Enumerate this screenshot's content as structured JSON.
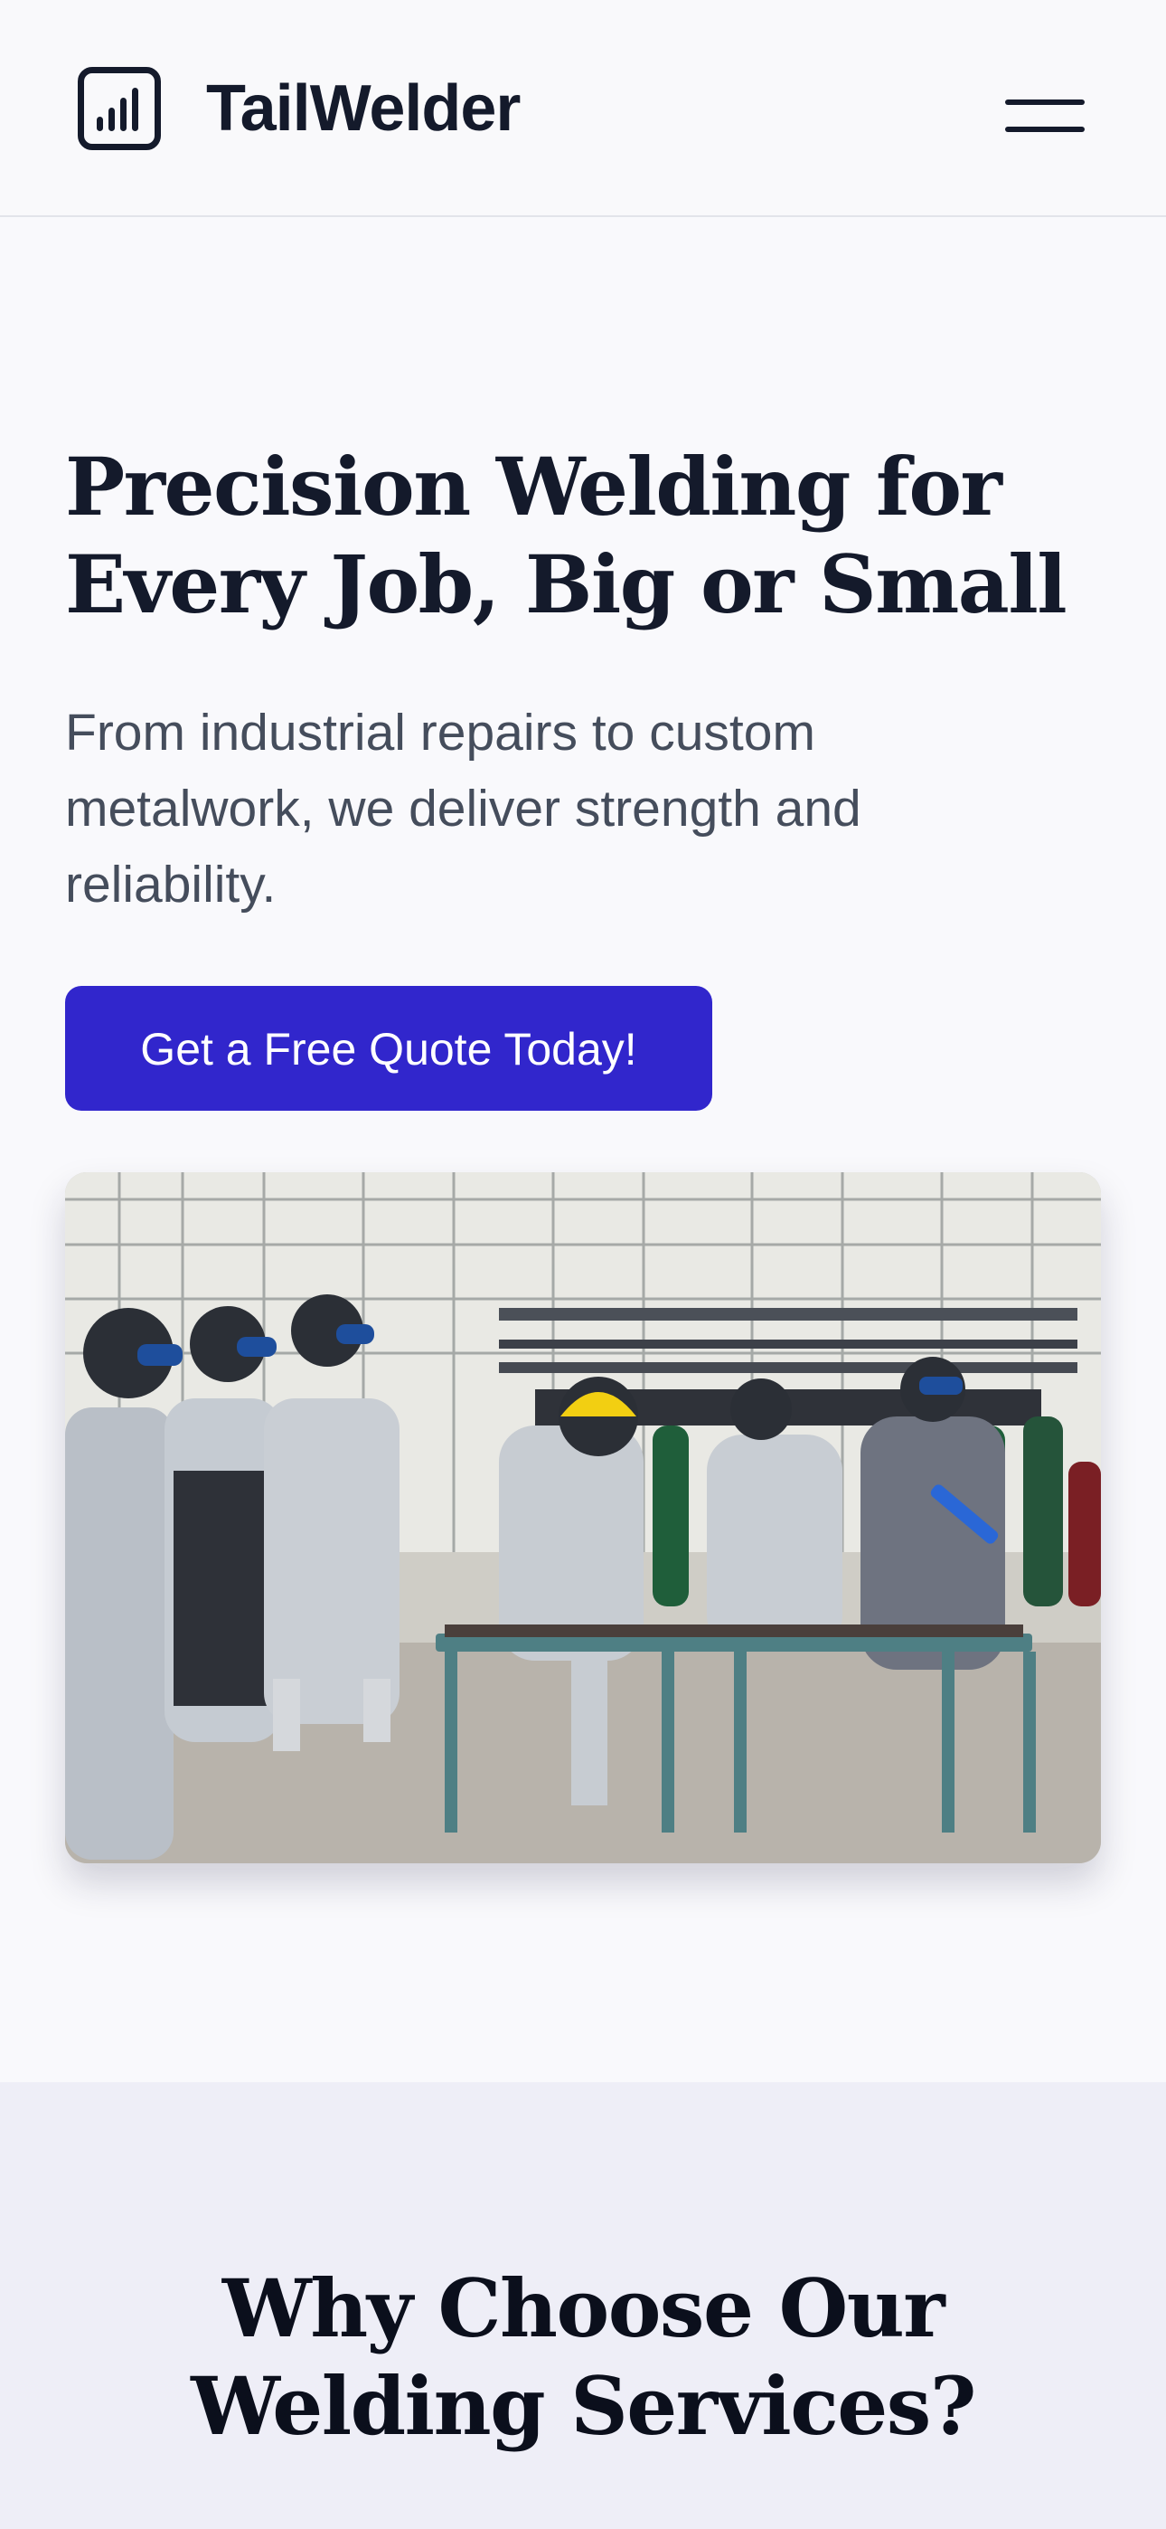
{
  "header": {
    "brand": "TailWelder",
    "logo_icon": "bar-chart-icon",
    "menu_icon": "hamburger-menu-icon"
  },
  "hero": {
    "title": "Precision Welding for Every Job, Big or Small",
    "subtitle": "From industrial repairs to custom metalwork, we deliver strength and reliability.",
    "cta_label": "Get a Free Quote Today!",
    "image_subject": "welders in protective gear at welding workbenches"
  },
  "why_section": {
    "title": "Why Choose Our Welding Services?"
  },
  "colors": {
    "accent": "#3126cc",
    "text_dark": "#141a2b",
    "text_muted": "#454d5c",
    "page_bg": "#f9f9fc",
    "section_bg": "#eeeef7"
  }
}
